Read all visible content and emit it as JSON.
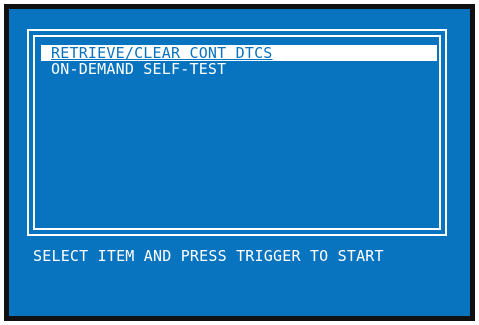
{
  "menu": {
    "items": [
      {
        "label": "RETRIEVE/CLEAR CONT DTCS",
        "selected": true
      },
      {
        "label": "ON-DEMAND SELF-TEST",
        "selected": false
      }
    ]
  },
  "footer": {
    "prompt": "SELECT ITEM AND PRESS TRIGGER TO START"
  },
  "colors": {
    "screen_background": "#0873bf",
    "bezel": "#111111",
    "text": "#ffffff",
    "highlight": "#ffffff"
  }
}
